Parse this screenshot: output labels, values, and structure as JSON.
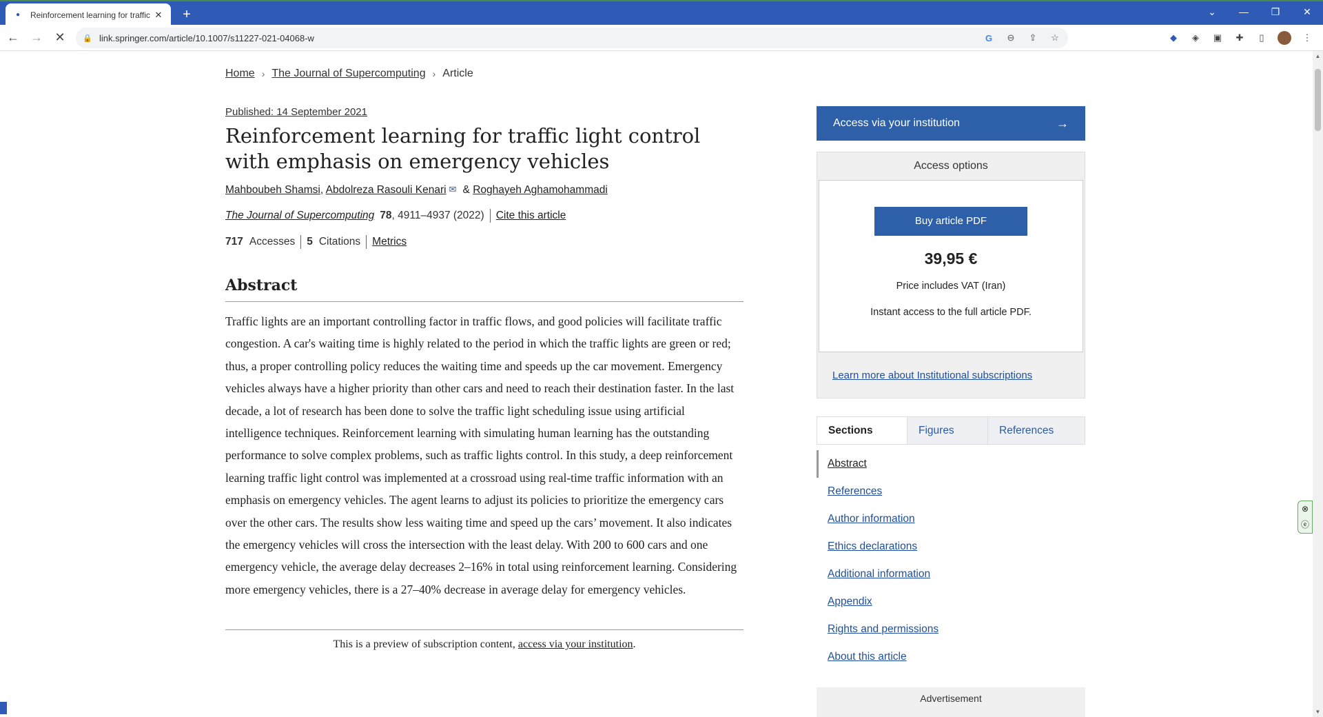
{
  "browser": {
    "tab_title": "Reinforcement learning for traffic",
    "url": "link.springer.com/article/10.1007/s11227-021-04068-w"
  },
  "breadcrumb": {
    "home": "Home",
    "journal": "The Journal of Supercomputing",
    "current": "Article"
  },
  "article": {
    "published": "Published: 14 September 2021",
    "title": "Reinforcement learning for traffic light control with emphasis on emergency vehicles",
    "authors": [
      "Mahboubeh Shamsi",
      "Abdolreza Rasouli Kenari",
      "Roghayeh Aghamohammadi"
    ],
    "author_sep_1": ",",
    "author_sep_2": "&",
    "journal": "The Journal of Supercomputing",
    "volume": "78",
    "pages": ", 4911–4937 (2022)",
    "cite": "Cite this article",
    "accesses_count": "717",
    "accesses_label": "Accesses",
    "citations_count": "5",
    "citations_label": "Citations",
    "metrics": "Metrics",
    "abstract_heading": "Abstract",
    "abstract_text": "Traffic lights are an important controlling factor in traffic flows, and good policies will facilitate traffic congestion. A car's waiting time is highly related to the period in which the traffic lights are green or red; thus, a proper controlling policy reduces the waiting time and speeds up the car movement. Emergency vehicles always have a higher priority than other cars and need to reach their destination faster. In the last decade, a lot of research has been done to solve the traffic light scheduling issue using artificial intelligence techniques. Reinforcement learning with simulating human learning has the outstanding performance to solve complex problems, such as traffic lights control. In this study, a deep reinforcement learning traffic light control was implemented at a crossroad using real-time traffic information with an emphasis on emergency vehicles. The agent learns to adjust its policies to prioritize the emergency cars over the other cars. The results show less waiting time and speed up the cars’ movement. It also indicates the emergency vehicles will cross the intersection with the least delay. With 200 to 600 cars and one emergency vehicle, the average delay decreases 2–16% in total using reinforcement learning. Considering more emergency vehicles, there is a 27–40% decrease in average delay for emergency vehicles.",
    "preview_text": "This is a preview of subscription content, ",
    "preview_link": "access via your institution",
    "preview_end": "."
  },
  "sidebar": {
    "access_button": "Access via your institution",
    "access_arrow": "→",
    "access_options": "Access options",
    "buy_button": "Buy article PDF",
    "price": "39,95 €",
    "vat": "Price includes VAT (Iran)",
    "instant": "Instant access to the full article PDF.",
    "learn_more": "Learn more about Institutional subscriptions",
    "tabs": [
      "Sections",
      "Figures",
      "References"
    ],
    "sections": [
      "Abstract",
      "References",
      "Author information",
      "Ethics declarations",
      "Additional information",
      "Appendix",
      "Rights and permissions",
      "About this article"
    ],
    "advertisement": "Advertisement"
  },
  "colors": {
    "brand_blue": "#2d60a8",
    "tabstrip": "#2f5bb7"
  }
}
